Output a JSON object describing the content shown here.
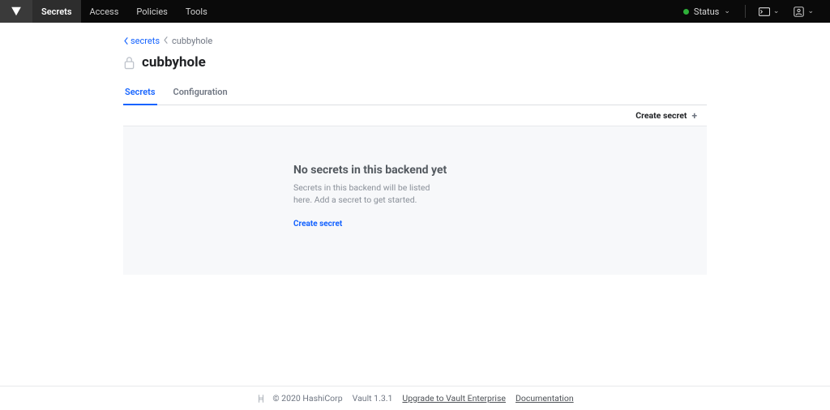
{
  "nav": {
    "items": [
      "Secrets",
      "Access",
      "Policies",
      "Tools"
    ],
    "status_label": "Status"
  },
  "breadcrumb": {
    "root": "secrets",
    "current": "cubbyhole"
  },
  "page": {
    "title": "cubbyhole"
  },
  "tabs": {
    "secrets": "Secrets",
    "configuration": "Configuration"
  },
  "toolbar": {
    "create_secret": "Create secret"
  },
  "empty": {
    "title": "No secrets in this backend yet",
    "desc": "Secrets in this backend will be listed here. Add a secret to get started.",
    "link": "Create secret"
  },
  "footer": {
    "copyright": "© 2020 HashiCorp",
    "version": "Vault 1.3.1",
    "upgrade": "Upgrade to Vault Enterprise",
    "docs": "Documentation"
  }
}
